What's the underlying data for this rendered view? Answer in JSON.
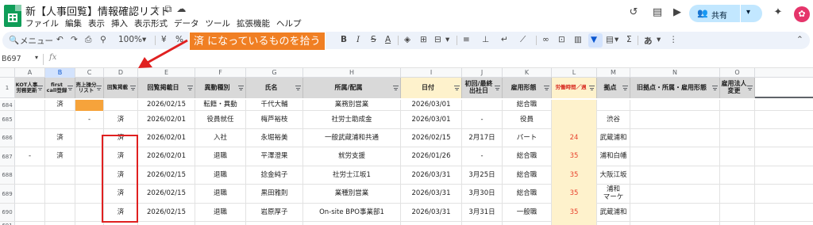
{
  "app": {
    "title": "新【人事回覧】情報確認リスト",
    "menu": [
      "ファイル",
      "編集",
      "表示",
      "挿入",
      "表示形式",
      "データ",
      "ツール",
      "拡張機能",
      "ヘルプ"
    ],
    "share_label": "共有",
    "avatar_letter": "✿"
  },
  "toolbar": {
    "search_label": "メニュー",
    "zoom": "100%",
    "currency": "¥",
    "percent": "%"
  },
  "callout": {
    "text": "済 になっているものを拾う",
    "color": "#f07f23"
  },
  "formula_bar": {
    "cell_ref": "B697",
    "fx": "fx"
  },
  "columns": [
    {
      "letter": "A",
      "header": "KOT人事労務更新"
    },
    {
      "letter": "B",
      "header": "first call登録"
    },
    {
      "letter": "C",
      "header": "売上操分リスト"
    },
    {
      "letter": "D",
      "header": "回覧掲載"
    },
    {
      "letter": "E",
      "header": "回覧掲載日"
    },
    {
      "letter": "F",
      "header": "異動種別"
    },
    {
      "letter": "G",
      "header": "氏名"
    },
    {
      "letter": "H",
      "header": "所属/配属"
    },
    {
      "letter": "I",
      "header": "日付"
    },
    {
      "letter": "J",
      "header": "初回/最終出社日"
    },
    {
      "letter": "K",
      "header": "雇用形態"
    },
    {
      "letter": "L",
      "header": "労働時間／週"
    },
    {
      "letter": "M",
      "header": "拠点"
    },
    {
      "letter": "N",
      "header": "旧拠点・所属・雇用形態"
    },
    {
      "letter": "O",
      "header": "雇用法人変更"
    }
  ],
  "header_row_number": "1",
  "rows": [
    {
      "num": "684",
      "cells": [
        "",
        "済",
        "",
        "",
        "2026/02/15",
        "転籍・異動",
        "千代大輔",
        "業務別営業",
        "2026/03/01",
        "",
        "総合職",
        "",
        "",
        "",
        ""
      ]
    },
    {
      "num": "685",
      "cells": [
        "",
        "",
        "-",
        "済",
        "2026/02/01",
        "役員就任",
        "梅芦裕枝",
        "社労士助成金",
        "2026/03/01",
        "-",
        "役員",
        "",
        "渋谷",
        "",
        ""
      ]
    },
    {
      "num": "686",
      "cells": [
        "",
        "済",
        "",
        "済",
        "2026/02/01",
        "入社",
        "永堀裕美",
        "一般武蔵浦和共通",
        "2026/02/15",
        "2月17日",
        "パート",
        "24",
        "武蔵浦和",
        "",
        ""
      ]
    },
    {
      "num": "687",
      "cells": [
        "-",
        "済",
        "",
        "済",
        "2026/02/01",
        "退職",
        "平澤澄果",
        "就労支援",
        "2026/01/26",
        "-",
        "総合職",
        "35",
        "浦和白幡",
        "",
        ""
      ]
    },
    {
      "num": "688",
      "cells": [
        "",
        "",
        "",
        "済",
        "2026/02/15",
        "退職",
        "捻金純子",
        "社労士江坂1",
        "2026/03/31",
        "3月25日",
        "総合職",
        "35",
        "大阪江坂",
        "",
        ""
      ]
    },
    {
      "num": "689",
      "cells": [
        "",
        "",
        "",
        "済",
        "2026/02/15",
        "退職",
        "黒田雅則",
        "業種別営業",
        "2026/03/31",
        "3月30日",
        "総合職",
        "35",
        "浦和\nマーケ",
        "",
        ""
      ]
    },
    {
      "num": "690",
      "cells": [
        "",
        "",
        "",
        "済",
        "2026/02/15",
        "退職",
        "岩原厚子",
        "On-site BPO事業部1",
        "2026/03/31",
        "3月31日",
        "一般職",
        "35",
        "武蔵浦和",
        "",
        ""
      ]
    },
    {
      "num": "691",
      "cells": [
        "",
        "",
        "",
        "",
        "",
        "",
        "",
        "",
        "",
        "",
        "",
        "",
        "",
        "",
        ""
      ]
    }
  ]
}
